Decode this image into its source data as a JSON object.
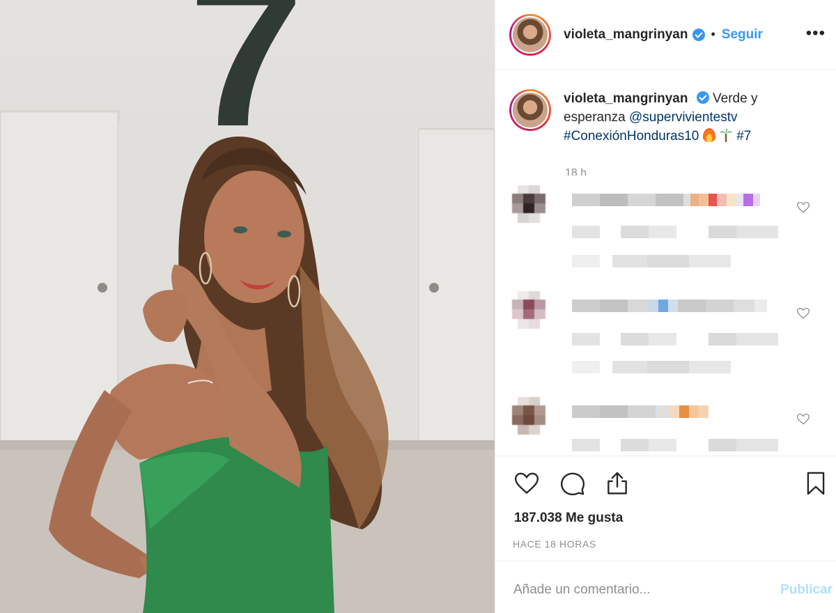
{
  "post": {
    "header": {
      "username": "violeta_mangrinyan",
      "separator": "•",
      "follow_label": "Seguir",
      "more_label": "•••"
    },
    "caption": {
      "username": "violeta_mangrinyan",
      "text_1": "Verde y esperanza",
      "mention": "@supervivientestv",
      "hashtag_1": "#ConexiónHonduras10",
      "hashtag_2": "#7",
      "timestamp": "18 h"
    },
    "comments": [
      {
        "avatar_color": "#4a3a3a",
        "blurred": true
      },
      {
        "avatar_color": "#8a4a5a",
        "blurred": true
      },
      {
        "avatar_color": "#7a5548",
        "blurred": true
      }
    ],
    "stats": {
      "likes": "187.038 Me gusta",
      "posted_ago": "HACE 18 HORAS"
    },
    "composer": {
      "placeholder": "Añade un comentario...",
      "publish_label": "Publicar"
    },
    "photo": {
      "background_number": "7",
      "dress_color": "#2f8a4c"
    },
    "colors": {
      "accent": "#3897f0",
      "publish_disabled": "#b2dffc",
      "link": "#003569"
    }
  }
}
